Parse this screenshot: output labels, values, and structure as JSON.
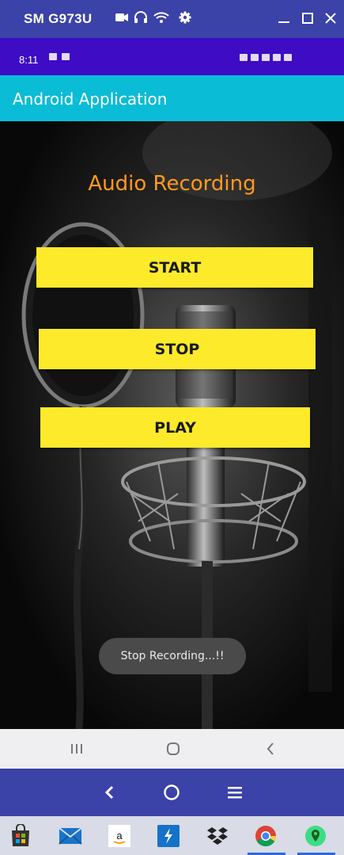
{
  "window": {
    "title": "SM G973U",
    "toolbar_icons": [
      "video-camera-icon",
      "headphones-icon",
      "wifi-icon",
      "settings-gear-icon"
    ],
    "controls": [
      "minimize-icon",
      "maximize-icon",
      "close-icon"
    ]
  },
  "status_bar": {
    "time": "8:11",
    "background": "#3d0cc4"
  },
  "app_bar": {
    "title": "Android Application",
    "background": "#0bbcd6"
  },
  "screen": {
    "heading": "Audio Recording",
    "heading_color": "#ff9a22",
    "buttons": [
      {
        "label": "START"
      },
      {
        "label": "STOP"
      },
      {
        "label": "PLAY"
      }
    ],
    "button_color": "#fdea2b",
    "toast": "Stop Recording...!!"
  },
  "android_nav": [
    "recents-icon",
    "home-icon",
    "back-icon"
  ],
  "emulator_nav": [
    "back-arrow-icon",
    "home-circle-icon",
    "menu-icon"
  ],
  "taskbar": {
    "apps": [
      "microsoft-store-icon",
      "mail-icon",
      "amazon-icon",
      "remote-app-icon",
      "dropbox-icon",
      "chrome-icon",
      "maps-app-icon"
    ]
  }
}
